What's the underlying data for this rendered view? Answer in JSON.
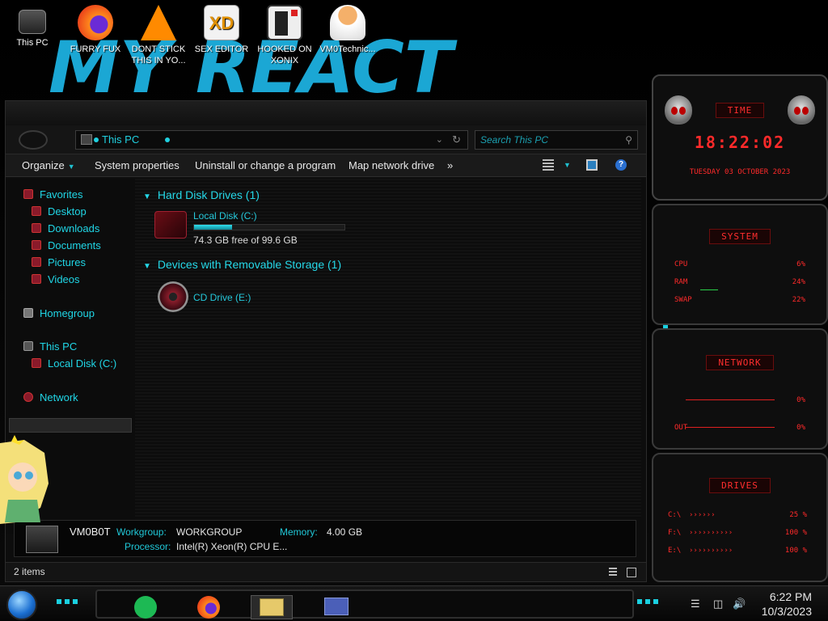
{
  "desktop": {
    "wallpaper_text": "MY REACT",
    "icons": [
      {
        "label": "This PC",
        "icon": "computer-icon"
      },
      {
        "label": "FURRY FUX",
        "icon": "firefox-icon"
      },
      {
        "label": "DONT STICK THIS IN YO...",
        "icon": "vlc-icon"
      },
      {
        "label": "SEX EDITOR",
        "icon": "hxd-editor-icon"
      },
      {
        "label": "HOOKED ON XONIX",
        "icon": "xonix-game-icon"
      },
      {
        "label": "VM0Technic...",
        "icon": "user-avatar-icon"
      }
    ]
  },
  "explorer": {
    "address": "This PC",
    "search_placeholder": "Search This PC",
    "toolbar": {
      "organize": "Organize",
      "system_properties": "System properties",
      "uninstall": "Uninstall or change a program",
      "map_drive": "Map network drive",
      "more": "»"
    },
    "nav": {
      "favorites": "Favorites",
      "desktop": "Desktop",
      "downloads": "Downloads",
      "documents": "Documents",
      "pictures": "Pictures",
      "videos": "Videos",
      "homegroup": "Homegroup",
      "this_pc": "This PC",
      "local_disk": "Local Disk (C:)",
      "network": "Network"
    },
    "groups": {
      "hdd": "Hard Disk Drives (1)",
      "removable": "Devices with Removable Storage (1)"
    },
    "drives": {
      "c_name": "Local Disk (C:)",
      "c_free": "74.3 GB free of 99.6 GB",
      "c_used_fraction": 0.254,
      "e_name": "CD Drive (E:)"
    },
    "details": {
      "pc_name": "VM0B0T",
      "workgroup_label": "Workgroup:",
      "workgroup_value": "WORKGROUP",
      "memory_label": "Memory:",
      "memory_value": "4.00 GB",
      "processor_label": "Processor:",
      "processor_value": "Intel(R) Xeon(R) CPU E..."
    },
    "status": "2 items"
  },
  "gadgets": {
    "time_header": "TIME",
    "time": "18:22:02",
    "date": "TUESDAY 03 OCTOBER 2023",
    "system_header": "SYSTEM",
    "cpu_label": "CPU",
    "cpu_value": "6%",
    "ram_label": "RAM",
    "ram_value": "24%",
    "swap_label": "SWAP",
    "swap_value": "22%",
    "network_header": "NETWORK",
    "in_value": "0%",
    "out_label": "OUT",
    "out_value": "0%",
    "drives_header": "DRIVES",
    "drive_rows": [
      {
        "label": "C:\\",
        "value": "25 %"
      },
      {
        "label": "F:\\",
        "value": "100 %"
      },
      {
        "label": "E:\\",
        "value": "100 %"
      }
    ]
  },
  "taskbar": {
    "time": "6:22 PM",
    "date": "10/3/2023",
    "apps": [
      "spotify-icon",
      "firefox-icon",
      "file-explorer-icon",
      "control-panel-icon"
    ]
  },
  "colors": {
    "accent": "#20d6e6",
    "gadget_red": "#ff2a2a",
    "background": "#0d0d0d"
  }
}
